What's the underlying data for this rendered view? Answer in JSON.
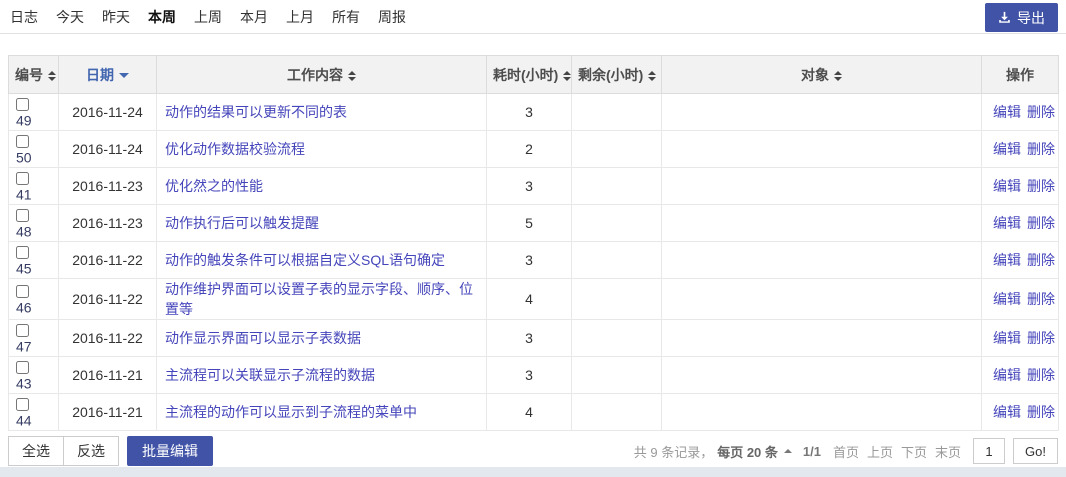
{
  "nav": {
    "items": [
      {
        "label": "日志",
        "active": false
      },
      {
        "label": "今天",
        "active": false
      },
      {
        "label": "昨天",
        "active": false
      },
      {
        "label": "本周",
        "active": true
      },
      {
        "label": "上周",
        "active": false
      },
      {
        "label": "本月",
        "active": false
      },
      {
        "label": "上月",
        "active": false
      },
      {
        "label": "所有",
        "active": false
      },
      {
        "label": "周报",
        "active": false
      }
    ],
    "export_label": "导出",
    "export_icon": "download-icon"
  },
  "table": {
    "headers": [
      {
        "label": "编号",
        "sort": "both"
      },
      {
        "label": "日期",
        "sort": "desc"
      },
      {
        "label": "工作内容",
        "sort": "both"
      },
      {
        "label": "耗时(小时)",
        "sort": "both"
      },
      {
        "label": "剩余(小时)",
        "sort": "both"
      },
      {
        "label": "对象",
        "sort": "both"
      },
      {
        "label": "操作",
        "sort": "none"
      }
    ],
    "rows": [
      {
        "id": "49",
        "date": "2016-11-24",
        "content": "动作的结果可以更新不同的表",
        "hours": "3",
        "remaining": "",
        "object": "",
        "edit": "编辑",
        "delete": "删除",
        "checked": false
      },
      {
        "id": "50",
        "date": "2016-11-24",
        "content": "优化动作数据校验流程",
        "hours": "2",
        "remaining": "",
        "object": "",
        "edit": "编辑",
        "delete": "删除",
        "checked": false
      },
      {
        "id": "41",
        "date": "2016-11-23",
        "content": "优化然之的性能",
        "hours": "3",
        "remaining": "",
        "object": "",
        "edit": "编辑",
        "delete": "删除",
        "checked": false
      },
      {
        "id": "48",
        "date": "2016-11-23",
        "content": "动作执行后可以触发提醒",
        "hours": "5",
        "remaining": "",
        "object": "",
        "edit": "编辑",
        "delete": "删除",
        "checked": false
      },
      {
        "id": "45",
        "date": "2016-11-22",
        "content": "动作的触发条件可以根据自定义SQL语句确定",
        "hours": "3",
        "remaining": "",
        "object": "",
        "edit": "编辑",
        "delete": "删除",
        "checked": false
      },
      {
        "id": "46",
        "date": "2016-11-22",
        "content": "动作维护界面可以设置子表的显示字段、顺序、位置等",
        "hours": "4",
        "remaining": "",
        "object": "",
        "edit": "编辑",
        "delete": "删除",
        "checked": false
      },
      {
        "id": "47",
        "date": "2016-11-22",
        "content": "动作显示界面可以显示子表数据",
        "hours": "3",
        "remaining": "",
        "object": "",
        "edit": "编辑",
        "delete": "删除",
        "checked": false
      },
      {
        "id": "43",
        "date": "2016-11-21",
        "content": "主流程可以关联显示子流程的数据",
        "hours": "3",
        "remaining": "",
        "object": "",
        "edit": "编辑",
        "delete": "删除",
        "checked": false
      },
      {
        "id": "44",
        "date": "2016-11-21",
        "content": "主流程的动作可以显示到子流程的菜单中",
        "hours": "4",
        "remaining": "",
        "object": "",
        "edit": "编辑",
        "delete": "删除",
        "checked": false
      }
    ]
  },
  "footer": {
    "select_all": "全选",
    "invert_select": "反选",
    "batch_edit": "批量编辑",
    "pagination": {
      "records": "共 9 条记录，",
      "per_page": "每页 20 条",
      "page_info": "1/1",
      "first": "首页",
      "prev": "上页",
      "next": "下页",
      "last": "末页",
      "input_value": "1",
      "go_label": "Go!"
    }
  },
  "colors": {
    "primary": "#4153a7",
    "link": "#4545bb",
    "sorted_header": "#4266b0",
    "header_bg": "#f2f2f2",
    "bottom_strip": "#e3e8ee"
  }
}
